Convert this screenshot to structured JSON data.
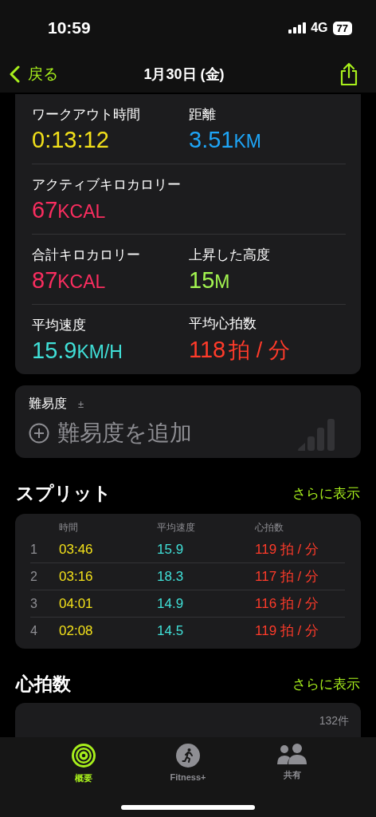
{
  "status_bar": {
    "time": "10:59",
    "network": "4G",
    "battery": "77"
  },
  "nav": {
    "back": "戻る",
    "title": "1月30日 (金)"
  },
  "metric_rows": [
    [
      {
        "label": "ワークアウト時間",
        "value": "0:13:12",
        "color": "#f2e01a"
      },
      {
        "label": "距離",
        "value": "3.51",
        "unit": "KM",
        "color": "#1ea5f7"
      }
    ],
    [
      {
        "label": "アクティブキロカロリー",
        "value": "67",
        "unit": "KCAL",
        "color": "#fa2d5f"
      }
    ],
    [
      {
        "label": "合計キロカロリー",
        "value": "87",
        "unit": "KCAL",
        "color": "#fa2d5f"
      },
      {
        "label": "上昇した高度",
        "value": "15",
        "unit": "M",
        "color": "#a3f550"
      }
    ],
    [
      {
        "label": "平均速度",
        "value": "15.9",
        "unit": "KM/H",
        "color": "#40e0d8"
      },
      {
        "label": "平均心拍数",
        "value": "118",
        "unit": "拍 / 分",
        "color": "#ff3b2a"
      }
    ]
  ],
  "difficulty": {
    "title": "難易度",
    "symbol": "±",
    "add": "難易度を追加"
  },
  "splits": {
    "title": "スプリット",
    "more": "さらに表示",
    "columns": [
      "時間",
      "平均速度",
      "心拍数"
    ],
    "rows": [
      {
        "index": "1",
        "time": "03:46",
        "speed": "15.9",
        "hr": "119 拍 / 分"
      },
      {
        "index": "2",
        "time": "03:16",
        "speed": "18.3",
        "hr": "117 拍 / 分"
      },
      {
        "index": "3",
        "time": "04:01",
        "speed": "14.9",
        "hr": "116 拍 / 分"
      },
      {
        "index": "4",
        "time": "02:08",
        "speed": "14.5",
        "hr": "119 拍 / 分"
      }
    ]
  },
  "heart_rate": {
    "title": "心拍数",
    "more": "さらに表示",
    "count": "132件"
  },
  "tabs": [
    {
      "kind": "rings",
      "label": "概要",
      "selected": true
    },
    {
      "kind": "fitness",
      "label": "Fitness+",
      "selected": false
    },
    {
      "kind": "sharing",
      "label": "共有",
      "selected": false
    }
  ]
}
